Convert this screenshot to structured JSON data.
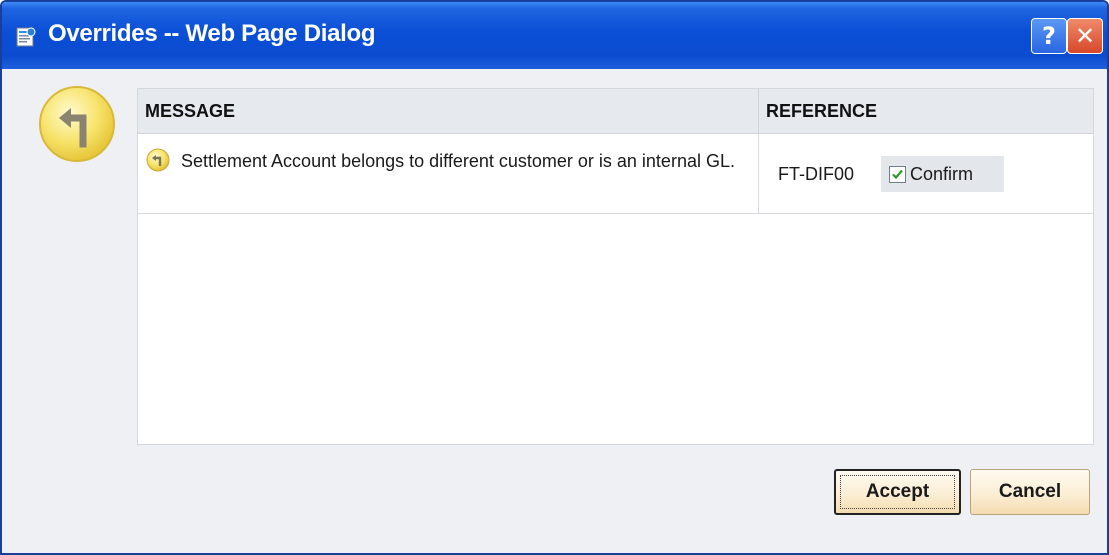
{
  "window": {
    "title": "Overrides -- Web Page Dialog",
    "help_label": "?",
    "close_label": "✕"
  },
  "table": {
    "headers": {
      "message": "MESSAGE",
      "reference": "REFERENCE"
    },
    "rows": [
      {
        "message": "Settlement Account belongs to different customer or is an internal GL.",
        "reference": "FT-DIF00",
        "confirm_label": "Confirm",
        "confirmed": true
      }
    ]
  },
  "buttons": {
    "accept": "Accept",
    "cancel": "Cancel"
  },
  "colors": {
    "titlebar": "#0a4fd6",
    "icon_yellow": "#f7e36a",
    "button_face": "#fbeed5",
    "check_green": "#2a9a2a"
  },
  "icons": {
    "title": "dialog-page-icon",
    "override": "turn-arrow-override-icon",
    "help": "help-icon",
    "close": "close-icon",
    "check": "checkmark-icon"
  }
}
